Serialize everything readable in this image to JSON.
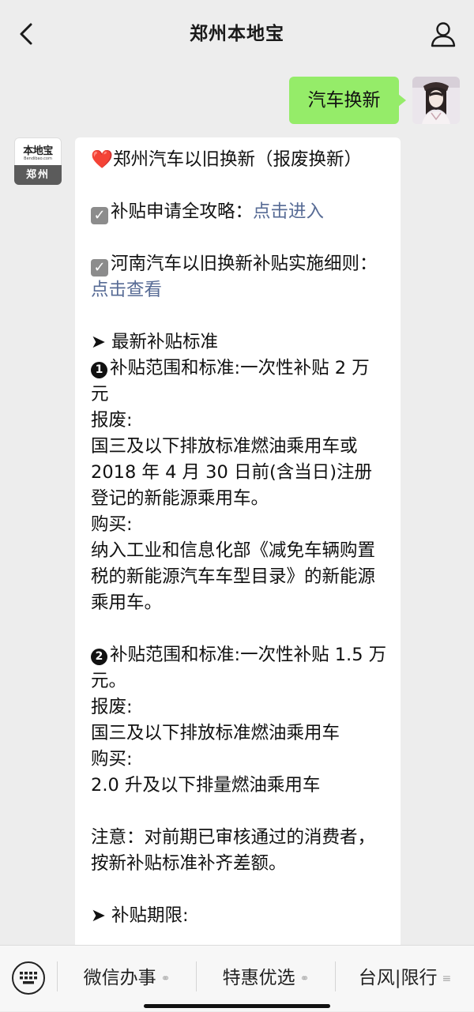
{
  "header": {
    "title": "郑州本地宝",
    "back_icon": "chevron-left-icon",
    "profile_icon": "person-icon"
  },
  "user_message": {
    "text": "汽车换新"
  },
  "bot": {
    "avatar": {
      "logo_text": "本地宝",
      "logo_sub": "Bendibao.com",
      "city": "郑州"
    },
    "message": {
      "line1": "❤️郑州汽车以旧换新（报废换新）",
      "guide_label": "补贴申请全攻略：",
      "guide_link": "点击进入",
      "rule_label": "河南汽车以旧换新补贴实施细则：",
      "rule_link": "点击查看",
      "section_heading": "➤ 最新补贴标准",
      "item1_title": "补贴范围和标准:一次性补贴 2 万元",
      "item1_scrap_label": "报废:",
      "item1_scrap_text": "国三及以下排放标准燃油乘用车或 2018 年 4 月 30 日前(含当日)注册登记的新能源乘用车。",
      "item1_buy_label": "购买:",
      "item1_buy_text": "纳入工业和信息化部《减免车辆购置税的新能源汽车车型目录》的新能源乘用车。",
      "item2_title": "补贴范围和标准:一次性补贴 1.5 万元。",
      "item2_scrap_label": "报废:",
      "item2_scrap_text": "国三及以下排放标准燃油乘用车",
      "item2_buy_label": "购买:",
      "item2_buy_text": "2.0 升及以下排量燃油乘用车",
      "note": "注意：对前期已审核通过的消费者，按新补贴标准补齐差额。",
      "next_heading": "➤ 补贴期限:"
    }
  },
  "bottom_menu": {
    "keyboard_icon": "keyboard-icon",
    "items": [
      {
        "label": "微信办事",
        "icon": "link-icon"
      },
      {
        "label": "特惠优选",
        "icon": "link-icon"
      },
      {
        "label": "台风|限行",
        "icon": "menu-lines-icon"
      }
    ]
  }
}
